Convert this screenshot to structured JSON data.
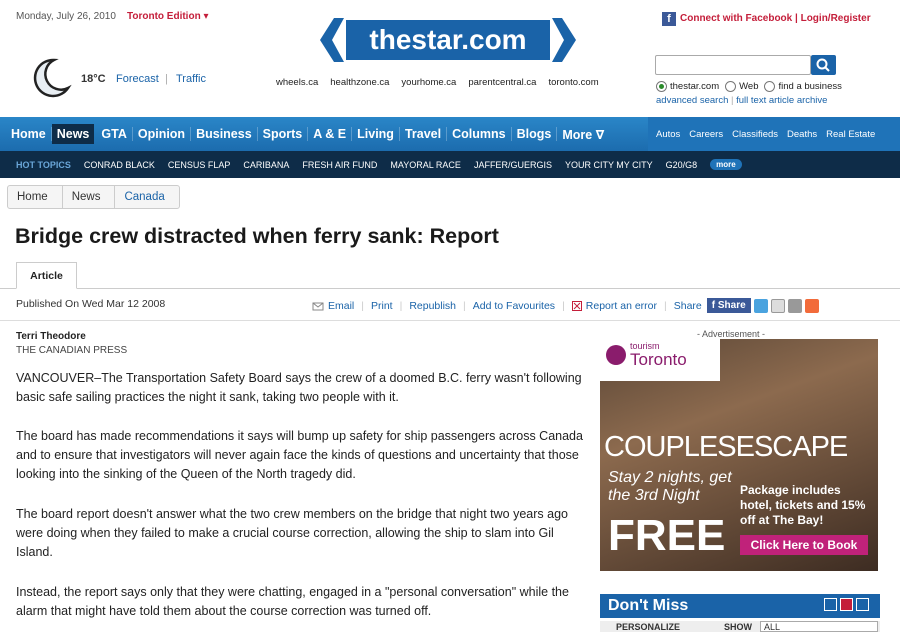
{
  "header": {
    "date": "Monday, July 26, 2010",
    "edition": "Toronto Edition ▾",
    "logo_text": "thestar.com",
    "facebook": "Connect with Facebook | Login/Register"
  },
  "weather": {
    "temp": "18°C",
    "forecast": "Forecast",
    "separator": "|",
    "traffic": "Traffic"
  },
  "site_links": [
    "wheels.ca",
    "healthzone.ca",
    "yourhome.ca",
    "parentcentral.ca",
    "toronto.com"
  ],
  "search": {
    "placeholder": "",
    "options": [
      "thestar.com",
      "Web",
      "find a business"
    ],
    "advanced": "advanced search",
    "separator": "|",
    "fulltext": "full text article archive"
  },
  "nav": {
    "items": [
      "Home",
      "News",
      "GTA",
      "Opinion",
      "Business",
      "Sports",
      "A & E",
      "Living",
      "Travel",
      "Columns",
      "Blogs",
      "More ∇"
    ],
    "active": "News",
    "right_items": [
      "Autos",
      "Careers",
      "Classifieds",
      "Deaths",
      "Real Estate"
    ]
  },
  "hot_topics": {
    "label": "HOT TOPICS",
    "items": [
      "CONRAD BLACK",
      "CENSUS FLAP",
      "CARIBANA",
      "FRESH AIR FUND",
      "MAYORAL RACE",
      "JAFFER/GUERGIS",
      "YOUR CITY MY CITY",
      "G20/G8"
    ],
    "more": "more"
  },
  "breadcrumb": [
    "Home",
    "News",
    "Canada"
  ],
  "article": {
    "headline": "Bridge crew distracted when ferry sank: Report",
    "tab": "Article",
    "published": "Published On Wed Mar 12 2008",
    "tools": [
      "Email",
      "Print",
      "Republish",
      "Add to Favourites",
      "Report an error"
    ],
    "share_label": "Share",
    "share_button": "f Share",
    "author": "Terri Theodore",
    "agency": "THE CANADIAN PRESS",
    "paragraphs": [
      "VANCOUVER–The Transportation Safety Board says the crew of a doomed B.C. ferry wasn't following basic safe sailing practices the night it sank, taking two people with it.",
      "The board has made recommendations it says will bump up safety for ship passengers across Canada and to ensure that investigators will never again face the kinds of questions and uncertainty that those looking into the sinking of the Queen of the North tragedy did.",
      "The board report doesn't answer what the two crew members on the bridge that night two years ago were doing when they failed to make a crucial course correction, allowing the ship to slam into Gil Island.",
      "Instead, the report says only that they were chatting, engaged in a \"personal conversation\" while the alarm that might have told them about the course correction was turned off."
    ]
  },
  "ad": {
    "label": "- Advertisement -",
    "brand_small": "tourism",
    "brand": "Toronto",
    "headline": "COUPLESESCAPE",
    "offer": "Stay 2 nights, get the 3rd Night",
    "free": "FREE",
    "package": "Package includes hotel, tickets and 15% off at The Bay!",
    "cta": "Click Here to Book"
  },
  "dont_miss": {
    "title": "Don't Miss",
    "personalize": "PERSONALIZE",
    "show": "SHOW",
    "show_value": "ALL"
  },
  "colors": {
    "brand_blue": "#1a63a8",
    "nav_dark": "#0e2c48",
    "accent_red": "#c41e3a"
  }
}
